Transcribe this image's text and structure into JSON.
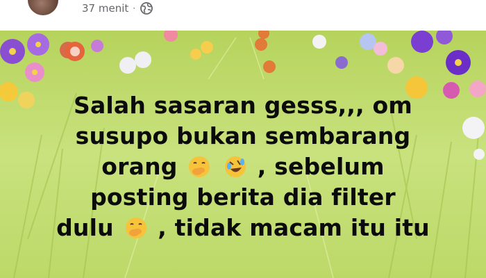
{
  "post": {
    "timestamp": "37 menit",
    "separator": "·",
    "audience_icon": "globe-icon",
    "lines": [
      "Salah sasaran gesss,,, om",
      "susupo bukan sembarang",
      "orang",
      ", sebelum",
      "posting berita dia filter",
      "dulu",
      ", tidak macam itu itu"
    ],
    "emojis": [
      "face-with-hand-over-mouth",
      "rolling-on-the-floor-laughing",
      "face-with-hand-over-mouth"
    ],
    "background_theme": "green meadow with flowers"
  },
  "colors": {
    "text": "#0b0b0b",
    "meta": "#65676b",
    "meadow": "#c5e07a"
  }
}
